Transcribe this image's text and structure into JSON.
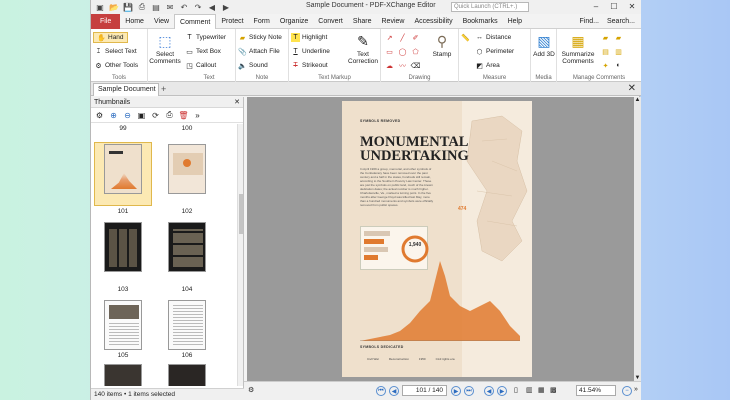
{
  "window": {
    "title": "Sample Document - PDF-XChange Editor",
    "quick_launch_placeholder": "Quick Launch (CTRL+.)",
    "minimize": "–",
    "maximize": "☐",
    "close": "✕"
  },
  "menu": {
    "tabs": [
      "File",
      "Home",
      "View",
      "Comment",
      "Protect",
      "Form",
      "Organize",
      "Convert",
      "Share",
      "Review",
      "Accessibility",
      "Bookmarks",
      "Help"
    ],
    "active": "Comment",
    "right_find": "Find...",
    "right_search": "Search..."
  },
  "ribbon": {
    "tools": {
      "label": "Tools",
      "hand": "Hand",
      "select_text": "Select Text",
      "other_tools": "Other Tools"
    },
    "select_comments": "Select Comments",
    "text": {
      "label": "Text",
      "typewriter": "Typewriter",
      "text_box": "Text Box",
      "callout": "Callout"
    },
    "note": {
      "label": "Note",
      "sticky_note": "Sticky Note",
      "attach_file": "Attach File",
      "sound": "Sound"
    },
    "text_markup": {
      "label": "Text Markup",
      "highlight": "Highlight",
      "underline": "Underline",
      "strikeout": "Strikeout",
      "text_correction": "Text Correction"
    },
    "drawing": {
      "label": "Drawing",
      "stamp": "Stamp"
    },
    "measure": {
      "label": "Measure",
      "distance": "Distance",
      "perimeter": "Perimeter",
      "area": "Area"
    },
    "media": {
      "label": "Media",
      "add_3d": "Add 3D"
    },
    "manage": {
      "label": "Manage Comments",
      "summarize": "Summarize Comments"
    }
  },
  "doc_tab": {
    "name": "Sample Document"
  },
  "thumbnails": {
    "title": "Thumbnails",
    "pages": [
      "99",
      "100",
      "101",
      "102",
      "103",
      "104",
      "105",
      "106"
    ],
    "selected": "101",
    "status": "140 items • 1 items selected"
  },
  "page_content": {
    "header": "SYMBOLS REMOVED",
    "title_line1": "MONUMENTAL",
    "title_line2": "UNDERTAKING",
    "body": "In April 1969 a group, memorial, and other symbols of the Confederacy have been removed over the past century and a half in the states, hundreds still remain, according to the Southern Poverty Law Center. These are just the symbols on public land, much of the known dedication dates; the actual number is much higher. Charlottesville, Va., marked a turning point. In the five months after George Floyd was killed last May, more than a hundred monuments and symbols were officially removed from public spaces.",
    "big_number": "1,940",
    "map_value": "474",
    "footer": "SYMBOLS DEDICATED",
    "legend_a": "Civil War",
    "legend_b": "Reconstruction",
    "legend_c": "1950",
    "legend_d": "Civil rights era"
  },
  "statusbar": {
    "page": "101 / 140",
    "zoom": "41.54%"
  },
  "colors": {
    "file_tab": "#c63f3f",
    "accent_orange": "#e07a2f"
  }
}
